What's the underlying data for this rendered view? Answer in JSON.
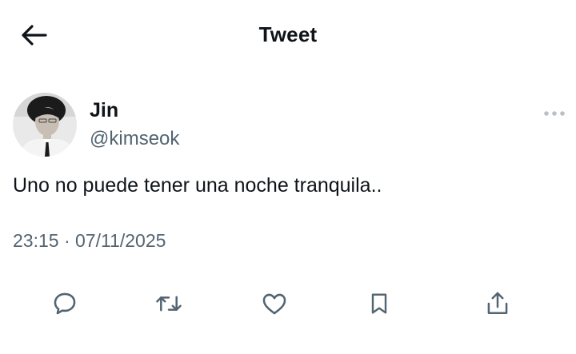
{
  "header": {
    "title": "Tweet",
    "back_icon": "arrow-left-icon"
  },
  "author": {
    "name": "Jin",
    "handle": "@kimseok"
  },
  "tweet": {
    "text": "Uno no puede tener una noche tranquila..",
    "time": "23:15",
    "separator": "·",
    "date": "07/11/2025"
  },
  "actions": {
    "icons": [
      "reply-icon",
      "retweet-icon",
      "like-icon",
      "bookmark-icon",
      "share-icon"
    ],
    "icon_color": "#536471"
  },
  "more_icon": "more-horizontal-icon"
}
